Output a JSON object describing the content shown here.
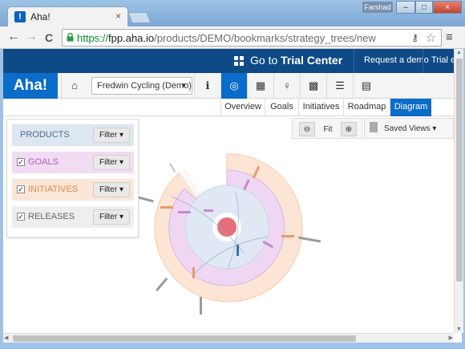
{
  "browser": {
    "tab_title": "Aha!",
    "tab_close": "×",
    "user_badge": "Farshad",
    "url_scheme": "https://",
    "url_host": "fpp.aha.io",
    "url_path": "/products/DEMO/bookmarks/strategy_trees/new",
    "back_icon": "←",
    "forward_icon": "→",
    "reload_icon": "C",
    "menu_icon": "≡",
    "star_icon": "☆",
    "key_icon": "⚷",
    "window_buttons": {
      "minimize": "–",
      "maximize": "□",
      "close": "×"
    }
  },
  "header": {
    "trial_center_prefix": "Go to ",
    "trial_center_bold": "Trial Center",
    "request_demo": "Request a demo",
    "trial_ends": "Trial ends"
  },
  "nav": {
    "logo": "Aha!",
    "product_select": "Fredwin Cycling (Demo)",
    "icons": {
      "home": "⌂",
      "info": "ℹ",
      "strategy": "◎",
      "calendar": "▦",
      "ideas": "♀",
      "features": "▩",
      "notes": "☰",
      "books": "▤"
    }
  },
  "subtabs": [
    "Overview",
    "Goals",
    "Initiatives",
    "Roadmap",
    "Diagram"
  ],
  "active_subtab": "Diagram",
  "panel": {
    "rows": [
      {
        "label": "PRODUCTS",
        "checked": false,
        "bg": "#dde6f1",
        "color": "#4a6d94"
      },
      {
        "label": "GOALS",
        "checked": true,
        "bg": "#f1dcf4",
        "color": "#b35cc2"
      },
      {
        "label": "INITIATIVES",
        "checked": true,
        "bg": "#fbe6d8",
        "color": "#e08a4a"
      },
      {
        "label": "RELEASES",
        "checked": true,
        "bg": "#eeeeee",
        "color": "#666666"
      }
    ],
    "filter_label": "Filter",
    "check_mark": "✓"
  },
  "zoom": {
    "zoom_out": "⊖",
    "fit": "Fit",
    "zoom_in": "⊕"
  },
  "saved_views": "Saved Views",
  "colors": {
    "brand": "#0b6cc9",
    "header": "#0e4a86",
    "products": "#dde6f1",
    "goals": "#efd7f3",
    "initiatives": "#fde5d5",
    "center": "#e46f7a"
  }
}
